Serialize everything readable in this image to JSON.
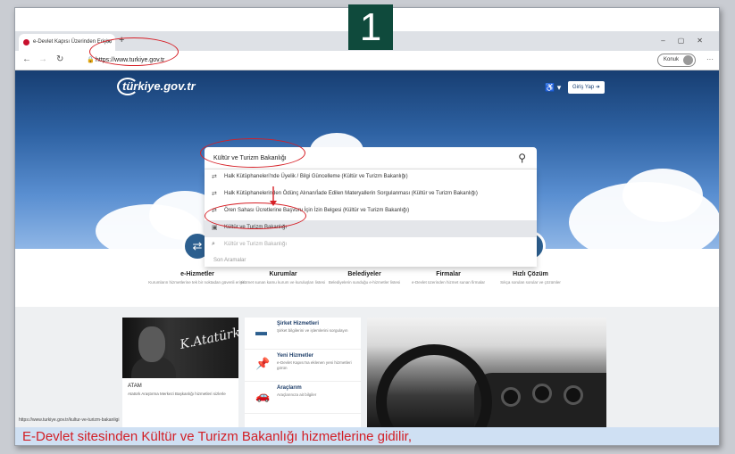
{
  "step_number": "1",
  "browser": {
    "tab_title": "e-Devlet Kapısı Üzerinden Erişim",
    "url": "https://www.turkiye.gov.tr",
    "profile_label": "Konuk"
  },
  "header": {
    "logo_text": "türkiye.gov.tr",
    "login_label": "Giriş Yap"
  },
  "search": {
    "query": "Kültür ve Turizm Bakanlığı",
    "suggestions": [
      {
        "label": "Halk Kütüphaneleri'nde Üyelik / Bilgi Güncelleme (Kültür ve Turizm Bakanlığı)",
        "state": "normal"
      },
      {
        "label": "Halk Kütüphanelerinden Ödünç Alınan/İade Edilen Materyallerin Sorgulanması (Kültür ve Turizm Bakanlığı)",
        "state": "normal"
      },
      {
        "label": "Ören Sahası Ücretlerine Başvuru İçin İzin Belgesi (Kültür ve Turizm Bakanlığı)",
        "state": "normal"
      },
      {
        "label": "Kültür ve Turizm Bakanlığı",
        "state": "selected"
      },
      {
        "label": "Kültür ve Turizm Bakanlığı",
        "state": "muted"
      }
    ],
    "recent_label": "Son Aramalar"
  },
  "categories": [
    {
      "title": "e-Hizmetler",
      "desc": "Kurumların hizmetlerine tek bir noktadan güvenli erişim"
    },
    {
      "title": "Kurumlar",
      "desc": "Hizmet sunan kamu kurum ve kuruluşları listesi"
    },
    {
      "title": "Belediyeler",
      "desc": "Belediyelerin sunduğu e-hizmetler listesi"
    },
    {
      "title": "Firmalar",
      "desc": "e-Devlet üzerinden hizmet sunan firmalar"
    },
    {
      "title": "Hızlı Çözüm",
      "desc": "Sıkça sorulan sorular ve çözümler"
    }
  ],
  "featured": {
    "title": "ATAM",
    "desc": "Atatürk Araştırma Merkezi Başkanlığı hizmetleri sizlerle",
    "signature": "K.Atatürk"
  },
  "services": [
    {
      "title": "Şirket Hizmetleri",
      "desc": "Şirket bilgilerini ve işlemlerini sorgulayın"
    },
    {
      "title": "Yeni Hizmetler",
      "desc": "e-Devlet Kapısı'na eklenen yeni hizmetleri görün"
    },
    {
      "title": "Araçlarım",
      "desc": "Araçlarınıza ait bilgiler"
    }
  ],
  "status_url": "https://www.turkiye.gov.tr/kultur-ve-turizm-bakanligi",
  "caption": "E-Devlet sitesinden Kültür ve Turizm Bakanlığı hizmetlerine gidilir,",
  "colors": {
    "annotation": "#d61f26",
    "badge": "#0f4a3c",
    "brand": "#173e72"
  }
}
